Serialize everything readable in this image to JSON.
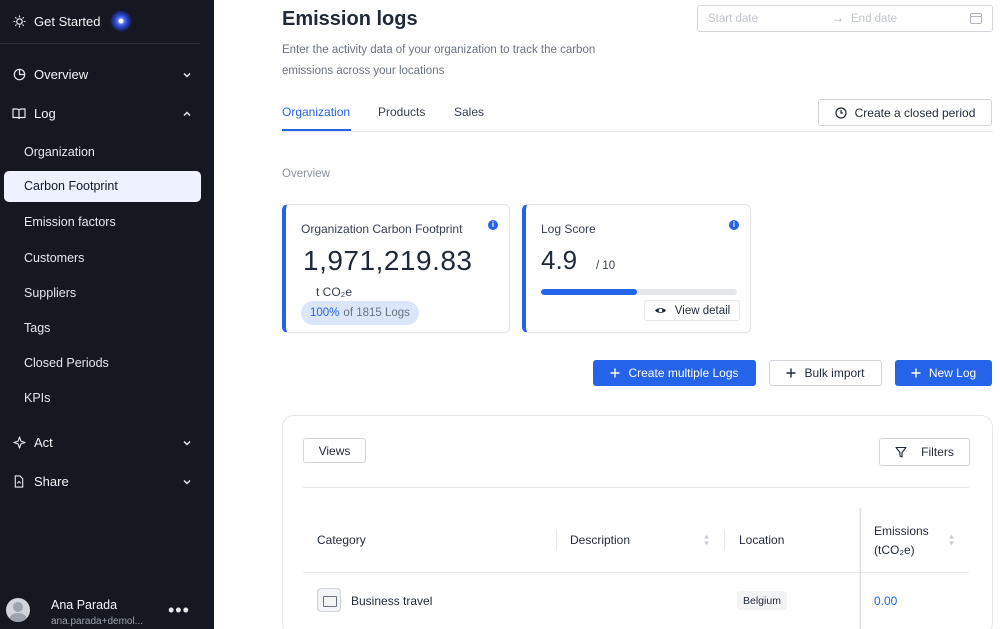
{
  "sidebar": {
    "get_started": "Get Started",
    "nav": {
      "overview": "Overview",
      "log": "Log",
      "act": "Act",
      "share": "Share"
    },
    "log_items": [
      "Organization",
      "Carbon Footprint",
      "Emission factors",
      "Customers",
      "Suppliers",
      "Tags",
      "Closed Periods",
      "KPIs"
    ],
    "active_item": "Carbon Footprint",
    "user": {
      "name": "Ana Parada",
      "email": "ana.parada+demol..."
    },
    "more_icon": "ellipsis-icon"
  },
  "header": {
    "title": "Emission logs",
    "subtitle": "Enter the activity data of your organization to track the carbon emissions across your locations",
    "date_range": {
      "start_placeholder": "Start date",
      "end_placeholder": "End date"
    }
  },
  "tabs": [
    "Organization",
    "Products",
    "Sales"
  ],
  "active_tab": "Organization",
  "closed_period_button": "Create a closed period",
  "overview_label": "Overview",
  "footprint_card": {
    "title": "Organization Carbon Footprint",
    "value": "1,971,219.83",
    "unit": "t CO₂e",
    "percent": "100%",
    "logs_text": "of 1815 Logs"
  },
  "log_score_card": {
    "title": "Log Score",
    "score": "4.9",
    "max": "/ 10",
    "progress": 0.49,
    "detail_button": "View detail"
  },
  "actions": {
    "create_multiple": "Create multiple Logs",
    "bulk_import": "Bulk import",
    "new_log": "New Log"
  },
  "table": {
    "views_button": "Views",
    "filters_button": "Filters",
    "columns": {
      "category": "Category",
      "description": "Description",
      "location": "Location",
      "emissions_line1": "Emissions",
      "emissions_line2": "(tCO₂e)"
    },
    "rows": [
      {
        "category": "Business travel",
        "description": "",
        "location": "Belgium",
        "emissions": "0.00"
      }
    ]
  },
  "colors": {
    "primary": "#2563eb",
    "sidebar_bg": "#151820",
    "active_bg": "#eef2ff"
  }
}
